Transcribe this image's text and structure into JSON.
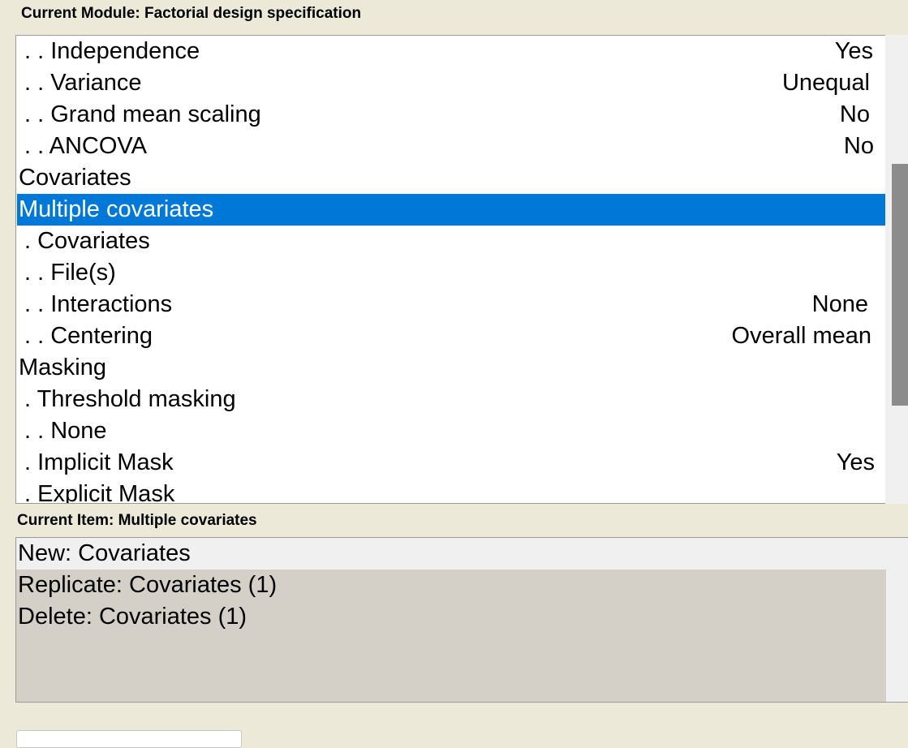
{
  "module_header": "Current Module: Factorial design specification",
  "item_header": "Current Item: Multiple covariates",
  "tree": [
    {
      "label": ". . Independence",
      "value": "Yes"
    },
    {
      "label": ". . Variance",
      "value": "Unequal"
    },
    {
      "label": ". . Grand mean scaling",
      "value": "No"
    },
    {
      "label": ". . ANCOVA",
      "value": "No"
    },
    {
      "label": "Covariates",
      "value": ""
    },
    {
      "label": "Multiple covariates",
      "value": ""
    },
    {
      "label": ". Covariates",
      "value": ""
    },
    {
      "label": ". . File(s)",
      "value": ""
    },
    {
      "label": ". . Interactions",
      "value": "None"
    },
    {
      "label": ". . Centering",
      "value": "Overall mean"
    },
    {
      "label": "Masking",
      "value": ""
    },
    {
      "label": ". Threshold masking",
      "value": ""
    },
    {
      "label": ". . None",
      "value": ""
    },
    {
      "label": ". Implicit Mask",
      "value": "Yes"
    },
    {
      "label": ". Explicit Mask",
      "value": ""
    }
  ],
  "selected_index": 5,
  "actions": [
    "New: Covariates",
    "Replicate: Covariates (1)",
    "Delete: Covariates (1)"
  ],
  "colors": {
    "selection": "#0078d7",
    "background": "#ece9d8",
    "panel": "#d4d0c8"
  }
}
